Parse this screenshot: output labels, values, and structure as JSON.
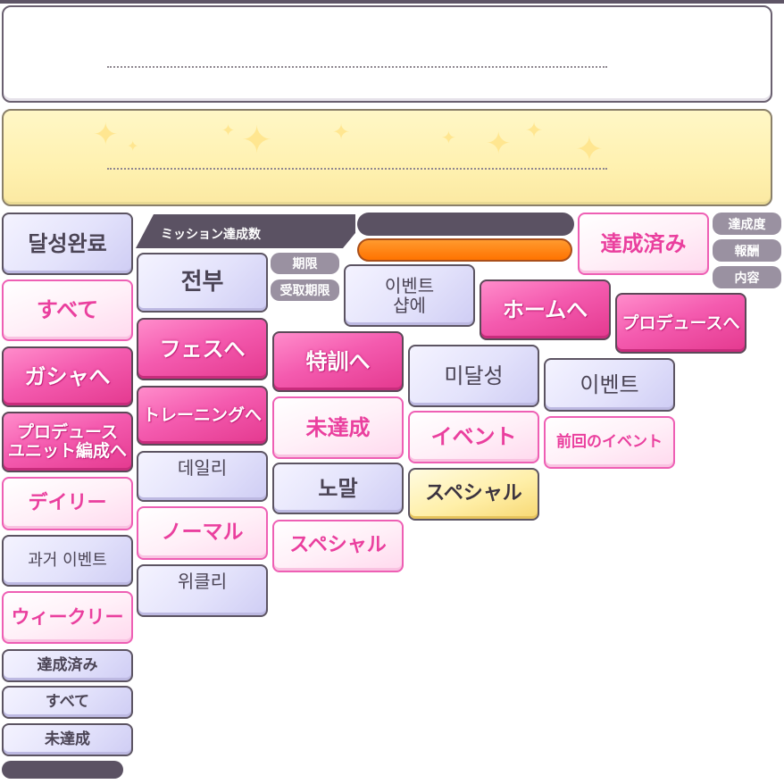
{
  "colors": {
    "pink": "#ea3f9e",
    "lavender": "#e3e2fb",
    "dark": "#5b5263",
    "orange": "#ff7a00",
    "yellow": "#fff3b8"
  },
  "header": {
    "mission_count_label": "ミッション達成数"
  },
  "tags": {
    "achievement_rate": "達成度",
    "reward": "報酬",
    "content": "内容",
    "period": "期限",
    "receive_period": "受取期限"
  },
  "buttons": {
    "achieve_complete_ko": "달성완료",
    "all_jp_pink": "すべて",
    "gacha_to": "ガシャへ",
    "produce_unit": "プロデュース\nユニット編成へ",
    "daily_jp": "デイリー",
    "past_event_ko": "과거 이벤트",
    "weekly_jp": "ウィークリー",
    "done_small": "達成済み",
    "all_small": "すべて",
    "notyet_small": "未達成",
    "all_ko": "전부",
    "fes_to": "フェスへ",
    "training_to": "トレーニングへ",
    "daily_ko": "데일리",
    "normal_jp": "ノーマル",
    "weekly_ko": "위클리",
    "event_shop_ko": "이벤트\n샵에",
    "special_training_to": "特訓へ",
    "notyet_pink": "未達成",
    "normal_ko": "노말",
    "special_jp_pink": "スペシャル",
    "achieved_pink": "達成済み",
    "home_to": "ホームへ",
    "produce_to": "プロデュースへ",
    "notyet_ko": "미달성",
    "event_jp": "イベント",
    "special_gold": "スペシャル",
    "event_ko": "이벤트",
    "prev_event_jp": "前回のイベント"
  }
}
